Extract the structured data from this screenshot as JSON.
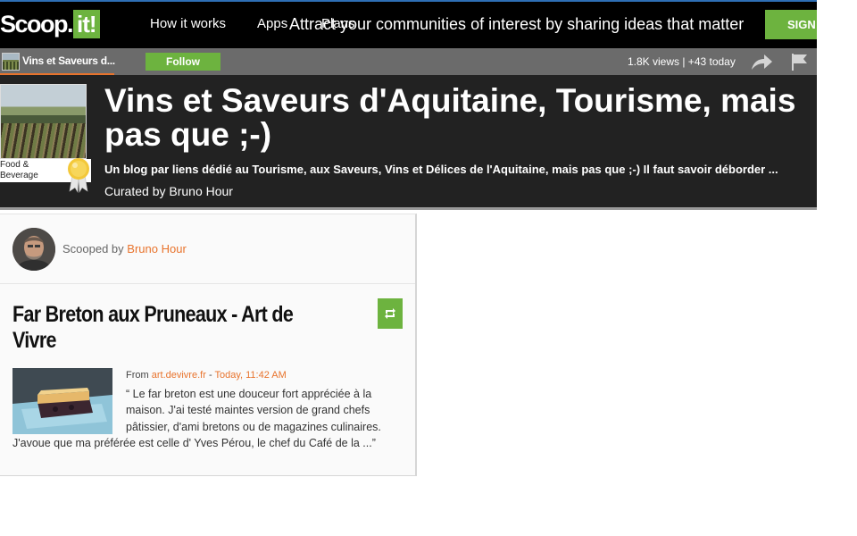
{
  "topbar": {
    "logo_text": "Scoop.",
    "logo_badge": "it!",
    "nav": {
      "how_it_works": "How it works",
      "apps": "Apps",
      "plans": "Plans"
    },
    "tagline": "Attract your communities of interest by sharing ideas that matter",
    "signup_label": "SIGN UP"
  },
  "strip": {
    "topic_short": "Vins et Saveurs d...",
    "follow_label": "Follow",
    "views": "1.8K views | +43 today"
  },
  "topic": {
    "category": "Food & Beverage",
    "title": "Vins et Saveurs d'Aquitaine, Tourisme, mais pas que ;-)",
    "description": "Un blog par liens dédié au Tourisme, aux Saveurs, Vins et Délices de l'Aquitaine, mais pas que ;-) Il faut savoir déborder ...",
    "curated_by": "Curated by Bruno Hour"
  },
  "post": {
    "scooped_prefix": "Scooped by",
    "curator": "Bruno Hour",
    "title": "Far Breton aux Pruneaux - Art de Vivre",
    "from_prefix": "From",
    "source": "art.devivre.fr",
    "separator": "-",
    "time": "Today, 11:42 AM",
    "excerpt": "“ Le far breton est une douceur fort appréciée à la maison. J'ai testé maintes version de grand chefs pâtissier, d'ami bretons ou de magazines culinaires. J'avoue que ma préférée est celle d' Yves Pérou, le chef du Café de la ...”"
  },
  "colors": {
    "accent_green": "#6db33f",
    "accent_orange": "#e8732c",
    "header_dark": "#222222",
    "strip_grey": "#6b6b6b"
  },
  "icons": {
    "share": "share-arrow-icon",
    "flag": "flag-icon",
    "rescoop": "rescoop-icon",
    "medal": "medal-icon"
  }
}
